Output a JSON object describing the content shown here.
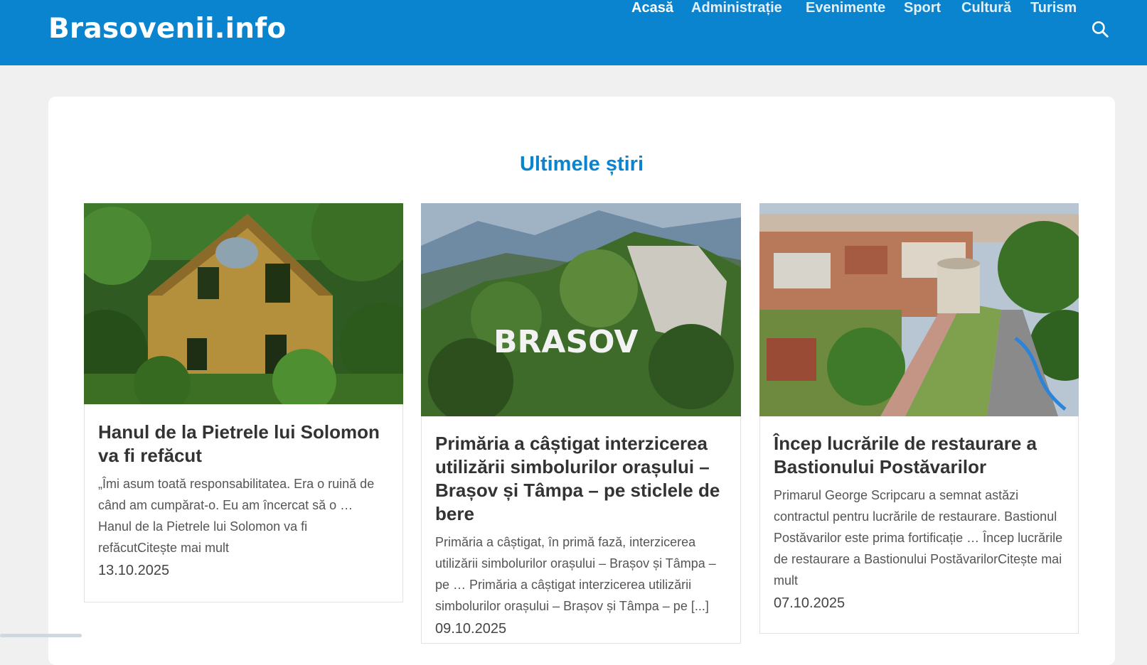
{
  "site": {
    "logo": "Brasovenii.info"
  },
  "nav": {
    "items": [
      {
        "label": "Acasă"
      },
      {
        "label": "Administrație"
      },
      {
        "label": "Evenimente"
      },
      {
        "label": "Sport"
      },
      {
        "label": "Cultură"
      },
      {
        "label": "Turism"
      }
    ],
    "search_icon": "search-icon"
  },
  "section": {
    "title": "Ultimele știri"
  },
  "cards": [
    {
      "title": "Hanul de la Pietrele lui Solomon va fi refăcut",
      "excerpt": "„Îmi asum toată responsabilitatea. Era o ruină de când am cumpărat-o. Eu am încercat să o … Hanul de la Pietrele lui Solomon va fi refăcutCitește mai mult",
      "date": "13.10.2025",
      "image": "ruined house in forest"
    },
    {
      "title": "Primăria a câștigat interzicerea utilizării simbolurilor orașului – Brașov și Tâmpa – pe sticlele de bere",
      "excerpt": "Primăria a câștigat, în primă fază, interzicerea utilizării simbolurilor orașului – Brașov și Tâmpa – pe … Primăria a câștigat interzicerea utilizării simbolurilor orașului – Brașov și Tâmpa – pe [...]",
      "date": "09.10.2025",
      "image_text": "BRASOV"
    },
    {
      "title": "Încep lucrările de restaurare a Bastionului Postăvarilor",
      "excerpt": "Primarul George Scripcaru a semnat astăzi contractul pentru lucrările de restaurare. Bastionul Postăvarilor este prima fortificație … Încep lucrările de restaurare a Bastionului PostăvarilorCitește mai mult",
      "date": "07.10.2025",
      "image": "aerial city view with bastion"
    }
  ],
  "colors": {
    "brand": "#0a84cf",
    "background": "#f0f0f1"
  }
}
